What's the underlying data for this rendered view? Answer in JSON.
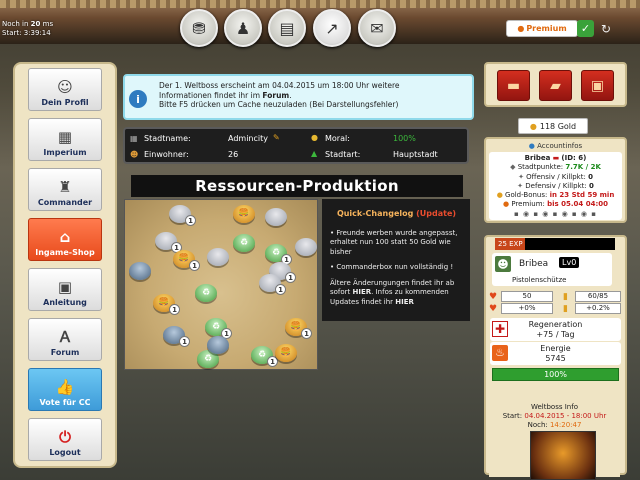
{
  "topbar": {
    "timer_label_1": "Noch",
    "timer_in": "in",
    "timer_minutes": "20",
    "timer_ms": "ms",
    "timer_label_2": "Start",
    "timer_time": "3:39:14",
    "premium_label": "Premium",
    "nav_icons": [
      "coins-stack-icon",
      "team-icon",
      "newspaper-icon",
      "stats-chart-icon",
      "scroll-icon"
    ]
  },
  "sidebar": {
    "items": [
      {
        "label": "Dein Profil",
        "icon": "profile-icon"
      },
      {
        "label": "Imperium",
        "icon": "chessboard-icon"
      },
      {
        "label": "Commander",
        "icon": "commander-icon"
      },
      {
        "label": "Ingame-Shop",
        "icon": "shop-icon"
      },
      {
        "label": "Anleitung",
        "icon": "manual-icon"
      },
      {
        "label": "Forum",
        "icon": "forum-icon"
      },
      {
        "label": "Vote für CC",
        "icon": "thumbs-up-icon"
      },
      {
        "label": "Logout",
        "icon": "power-icon"
      }
    ]
  },
  "info": {
    "line1": "Der 1. Weltboss erscheint am 04.04.2015 um 18:00 Uhr weitere",
    "line2_pre": "Informationen findet ihr im ",
    "line2_link": "Forum",
    "line2_post": ".",
    "line3": "Bitte F5 drücken um Cache neuzuladen (Bei Darstellungsfehler)"
  },
  "stats": {
    "city_label": "Stadtname:",
    "city_value": "Admincity",
    "morale_label": "Moral:",
    "morale_value": "100%",
    "residents_label": "Einwohner:",
    "residents_value": "26",
    "start_label": "Stadtart:",
    "start_value": "Hauptstadt"
  },
  "heading": "Ressourcen-Produktion",
  "map": {
    "tiles": [
      {
        "type": "s",
        "level": "1"
      },
      {
        "type": "f",
        "level": ""
      },
      {
        "type": "s",
        "level": ""
      },
      {
        "type": "s",
        "level": "1"
      },
      {
        "type": "g",
        "level": ""
      },
      {
        "type": "f",
        "level": "1"
      },
      {
        "type": "s",
        "level": ""
      },
      {
        "type": "g",
        "level": "1"
      },
      {
        "type": "s",
        "level": ""
      },
      {
        "type": "b",
        "level": ""
      },
      {
        "type": "s",
        "level": "1"
      },
      {
        "type": "f",
        "level": "1"
      },
      {
        "type": "g",
        "level": ""
      },
      {
        "type": "s",
        "level": "1"
      },
      {
        "type": "g",
        "level": "1"
      },
      {
        "type": "b",
        "level": "1"
      },
      {
        "type": "f",
        "level": "1"
      },
      {
        "type": "g",
        "level": ""
      },
      {
        "type": "b",
        "level": ""
      },
      {
        "type": "g",
        "level": "1"
      },
      {
        "type": "f",
        "level": ""
      }
    ]
  },
  "changelog": {
    "title_pre": "Quick-Changelog ",
    "title_tag": "(Update)",
    "item1": "• Freunde werben wurde angepasst, erhaltet nun 100 statt 50 Gold wie bisher",
    "item2": "• Commanderbox nun vollständig !",
    "older_pre": "Ältere Änderungungen findet ihr ab sofort ",
    "older_link1": "HIER",
    "older_mid": ". Infos zu kommenden Updates findet ihr ",
    "older_link2": "HIER"
  },
  "gold": {
    "value": "118 Gold"
  },
  "account": {
    "title": "Accountinfos",
    "name": "Bribea",
    "id": "(ID: 6)",
    "stadtpunkte_label": "Stadtpunkte:",
    "stadtpunkte_value": "7.7K / 2K",
    "offensiv_label": "Offensiv / Killpkt:",
    "offensiv_value": "0",
    "defensiv_label": "Defensiv / Killpkt:",
    "defensiv_value": "0",
    "goldbonus_label": "Gold-Bonus:",
    "goldbonus_value": "in 23 Std 59 min",
    "premium_label": "Premium:",
    "premium_value": "bis 05.04 04:00"
  },
  "character": {
    "exp_label": "25 EXP",
    "exp_fraction": 0.25,
    "name": "Bribea",
    "level": "Lv0",
    "class": "Pistolenschütze",
    "hp": "50",
    "ammo": "60/85",
    "hp_bonus": "+0%",
    "ammo_bonus": "+0.2%",
    "regen_label": "Regeneration",
    "regen_value": "+75 / Tag",
    "energy_label": "Energie",
    "energy_value": "5745",
    "green_bar": "100%"
  },
  "worldboss": {
    "title": "Weltboss Info",
    "start_label": "Start: ",
    "start_value": "04.04.2015 - 18:00 Uhr",
    "noch_label": "Noch: ",
    "noch_value": "14:20:47"
  }
}
